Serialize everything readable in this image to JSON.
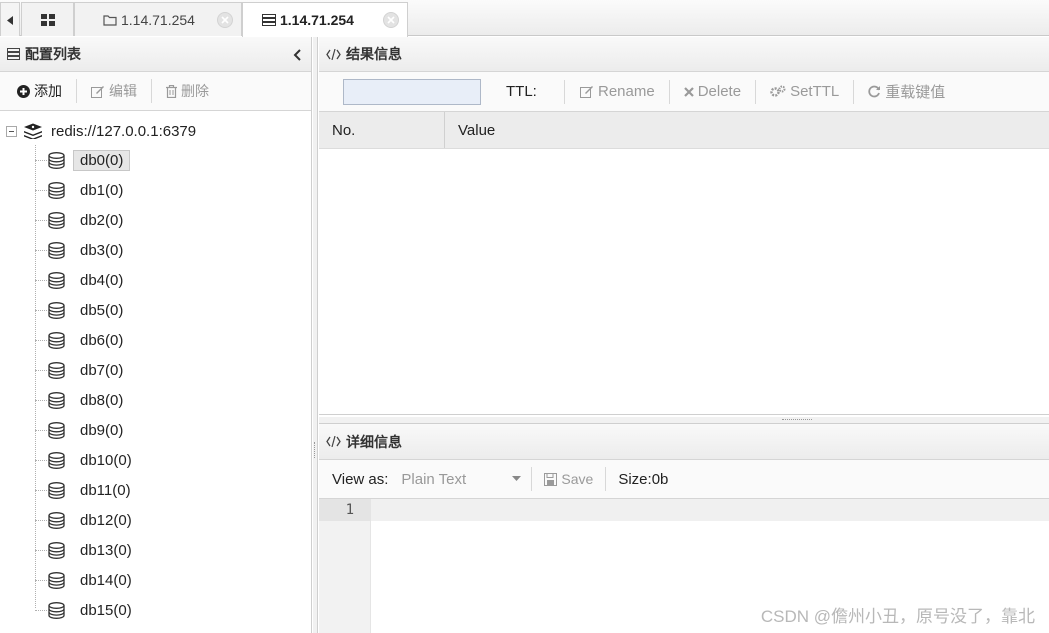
{
  "tabs": {
    "home_icon": "grid-icon",
    "items": [
      {
        "label": "1.14.71.254",
        "icon": "folder-icon",
        "active": false
      },
      {
        "label": "1.14.71.254",
        "icon": "server-icon",
        "active": true
      }
    ]
  },
  "config_panel": {
    "title": "配置列表",
    "toolbar": {
      "add": "添加",
      "edit": "编辑",
      "delete": "删除"
    },
    "tree": {
      "root": "redis://127.0.0.1:6379",
      "selected": "db0(0)",
      "databases": [
        "db0(0)",
        "db1(0)",
        "db2(0)",
        "db3(0)",
        "db4(0)",
        "db5(0)",
        "db6(0)",
        "db7(0)",
        "db8(0)",
        "db9(0)",
        "db10(0)",
        "db11(0)",
        "db12(0)",
        "db13(0)",
        "db14(0)",
        "db15(0)"
      ]
    }
  },
  "result_panel": {
    "title": "结果信息",
    "key_value": "",
    "ttl_label": "TTL:",
    "rename": "Rename",
    "delete": "Delete",
    "setttl": "SetTTL",
    "reload": "重载键值",
    "columns": [
      "No.",
      "Value"
    ]
  },
  "detail_panel": {
    "title": "详细信息",
    "view_as_label": "View as:",
    "view_as_value": "Plain Text",
    "save": "Save",
    "size": "Size:0b",
    "line_number": "1"
  },
  "watermark": "CSDN @儋州小丑，原号没了，靠北",
  "colors": {
    "selected_bg": "#e6e6e6",
    "input_bg": "#e8eef8",
    "header_bg": "#ececec"
  }
}
